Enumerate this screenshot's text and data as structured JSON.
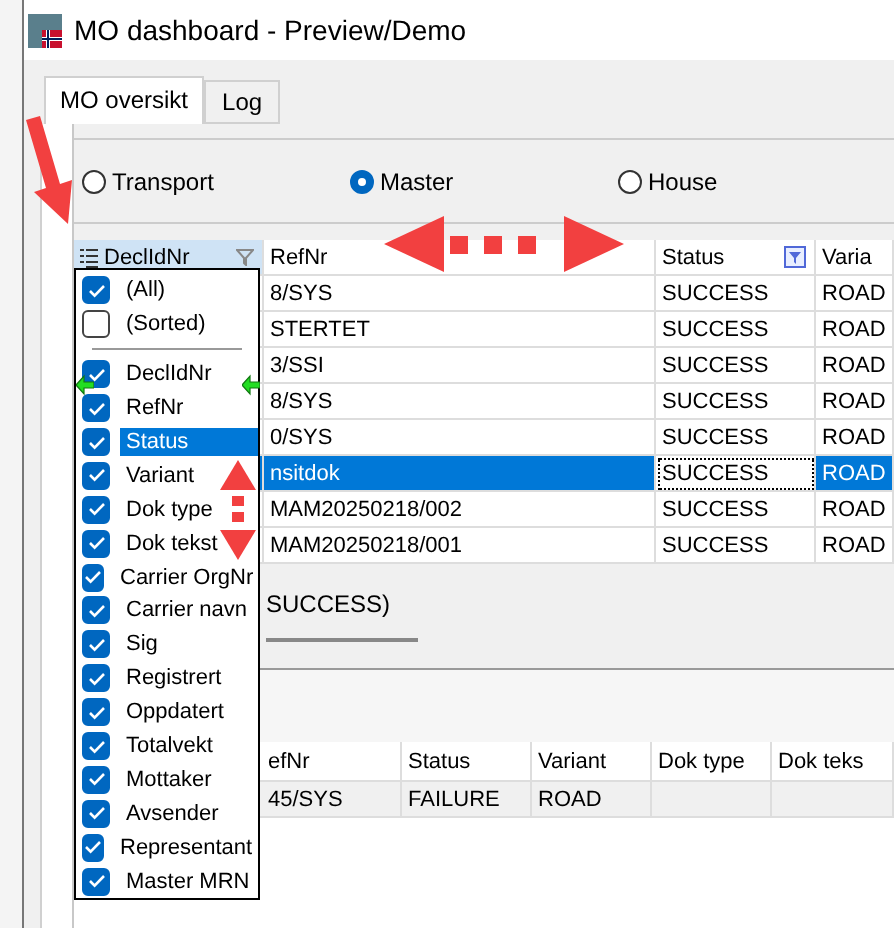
{
  "window": {
    "title": "MO dashboard - Preview/Demo"
  },
  "tabs": [
    {
      "label": "MO oversikt",
      "selected": true
    },
    {
      "label": "Log",
      "selected": false
    }
  ],
  "mode_options": [
    {
      "label": "Transport",
      "selected": false
    },
    {
      "label": "Master",
      "selected": true
    },
    {
      "label": "House",
      "selected": false
    }
  ],
  "grid": {
    "columns": [
      {
        "label": "DeclIdNr",
        "filter_active": false
      },
      {
        "label": "RefNr"
      },
      {
        "label": "Status",
        "filter_active": true
      },
      {
        "label": "Varia"
      }
    ],
    "rows": [
      {
        "selected": false,
        "cells": [
          {
            "text": "",
            "focused": false
          },
          {
            "text": "8/SYS",
            "focused": false
          },
          {
            "text": "SUCCESS",
            "focused": false
          },
          {
            "text": "ROAD",
            "focused": false
          }
        ]
      },
      {
        "selected": false,
        "cells": [
          {
            "text": "",
            "focused": false
          },
          {
            "text": "STERTET",
            "focused": false
          },
          {
            "text": "SUCCESS",
            "focused": false
          },
          {
            "text": "ROAD",
            "focused": false
          }
        ]
      },
      {
        "selected": false,
        "cells": [
          {
            "text": "",
            "focused": false
          },
          {
            "text": "3/SSI",
            "focused": false
          },
          {
            "text": "SUCCESS",
            "focused": false
          },
          {
            "text": "ROAD",
            "focused": false
          }
        ]
      },
      {
        "selected": false,
        "cells": [
          {
            "text": "",
            "focused": false
          },
          {
            "text": "8/SYS",
            "focused": false
          },
          {
            "text": "SUCCESS",
            "focused": false
          },
          {
            "text": "ROAD",
            "focused": false
          }
        ]
      },
      {
        "selected": false,
        "cells": [
          {
            "text": "",
            "focused": false
          },
          {
            "text": "0/SYS",
            "focused": false
          },
          {
            "text": "SUCCESS",
            "focused": false
          },
          {
            "text": "ROAD",
            "focused": false
          }
        ]
      },
      {
        "selected": true,
        "cells": [
          {
            "text": "",
            "focused": false
          },
          {
            "text": "nsitdok",
            "focused": false
          },
          {
            "text": "SUCCESS",
            "focused": true
          },
          {
            "text": "ROAD",
            "focused": false
          }
        ]
      },
      {
        "selected": false,
        "cells": [
          {
            "text": "",
            "focused": false
          },
          {
            "text": "MAM20250218/002",
            "focused": false
          },
          {
            "text": "SUCCESS",
            "focused": false
          },
          {
            "text": "ROAD",
            "focused": false
          }
        ]
      },
      {
        "selected": false,
        "cells": [
          {
            "text": "",
            "focused": false
          },
          {
            "text": "MAM20250218/001",
            "focused": false
          },
          {
            "text": "SUCCESS",
            "focused": false
          },
          {
            "text": "ROAD",
            "focused": false
          }
        ]
      }
    ]
  },
  "filter_text": "SUCCESS)",
  "column_chooser": {
    "special_items": [
      {
        "label": "(All)",
        "checked": true
      },
      {
        "label": "(Sorted)",
        "checked": false
      }
    ],
    "column_items": [
      {
        "label": "DeclIdNr",
        "checked": true,
        "highlighted": false
      },
      {
        "label": "RefNr",
        "checked": true,
        "highlighted": false
      },
      {
        "label": "Status",
        "checked": true,
        "highlighted": true
      },
      {
        "label": "Variant",
        "checked": true,
        "highlighted": false
      },
      {
        "label": "Dok type",
        "checked": true,
        "highlighted": false
      },
      {
        "label": "Dok tekst",
        "checked": true,
        "highlighted": false
      },
      {
        "label": "Carrier OrgNr",
        "checked": true,
        "highlighted": false
      },
      {
        "label": "Carrier navn",
        "checked": true,
        "highlighted": false
      },
      {
        "label": "Sig",
        "checked": true,
        "highlighted": false
      },
      {
        "label": "Registrert",
        "checked": true,
        "highlighted": false
      },
      {
        "label": "Oppdatert",
        "checked": true,
        "highlighted": false
      },
      {
        "label": "Totalvekt",
        "checked": true,
        "highlighted": false
      },
      {
        "label": "Mottaker",
        "checked": true,
        "highlighted": false
      },
      {
        "label": "Avsender",
        "checked": true,
        "highlighted": false
      },
      {
        "label": "Representant",
        "checked": true,
        "highlighted": false
      },
      {
        "label": "Master MRN",
        "checked": true,
        "highlighted": false
      }
    ]
  },
  "detail_grid": {
    "columns": [
      "efNr",
      "Status",
      "Variant",
      "Dok type",
      "Dok teks"
    ],
    "rows": [
      [
        "45/SYS",
        "FAILURE",
        "ROAD"
      ]
    ]
  }
}
